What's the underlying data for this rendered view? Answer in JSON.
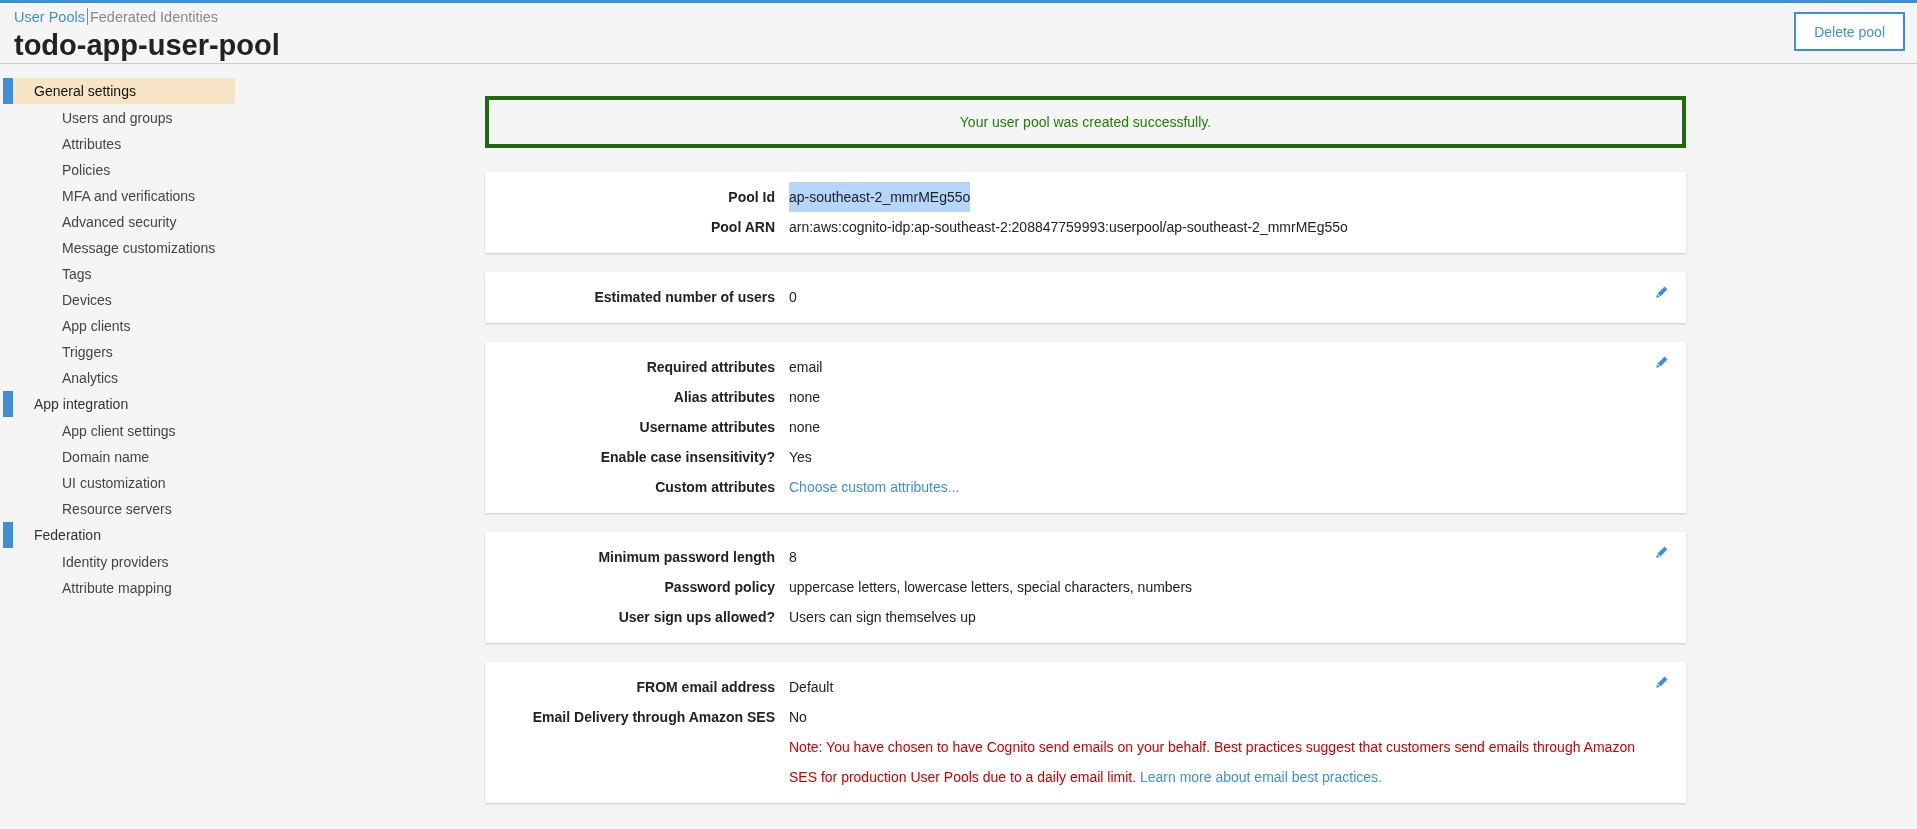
{
  "breadcrumb": [
    {
      "label": "User Pools",
      "selected": true
    },
    {
      "label": "Federated Identities",
      "selected": false
    }
  ],
  "title": "todo-app-user-pool",
  "delete_button": "Delete pool",
  "sidebar": {
    "items": [
      {
        "label": "General settings",
        "selected": true,
        "children": [
          {
            "label": "Users and groups"
          },
          {
            "label": "Attributes"
          },
          {
            "label": "Policies"
          },
          {
            "label": "MFA and verifications"
          },
          {
            "label": "Advanced security"
          },
          {
            "label": "Message customizations"
          },
          {
            "label": "Tags"
          },
          {
            "label": "Devices"
          },
          {
            "label": "App clients"
          },
          {
            "label": "Triggers"
          },
          {
            "label": "Analytics"
          }
        ]
      },
      {
        "label": "App integration",
        "selected": false,
        "children": [
          {
            "label": "App client settings"
          },
          {
            "label": "Domain name"
          },
          {
            "label": "UI customization"
          },
          {
            "label": "Resource servers"
          }
        ]
      },
      {
        "label": "Federation",
        "selected": false,
        "children": [
          {
            "label": "Identity providers"
          },
          {
            "label": "Attribute mapping"
          }
        ]
      }
    ]
  },
  "success_message": "Your user pool was created successfully.",
  "cards": [
    {
      "editable": false,
      "rows": [
        {
          "label": "Pool Id",
          "kind": "text",
          "value": "ap-southeast-2_mmrMEg55o",
          "highlighted": true
        },
        {
          "label": "Pool ARN",
          "kind": "text",
          "value": "arn:aws:cognito-idp:ap-southeast-2:208847759993:userpool/ap-southeast-2_mmrMEg55o",
          "highlighted": false
        }
      ]
    },
    {
      "editable": true,
      "rows": [
        {
          "label": "Estimated number of users",
          "kind": "text",
          "value": "0",
          "highlighted": false
        }
      ]
    },
    {
      "editable": true,
      "rows": [
        {
          "label": "Required attributes",
          "kind": "text",
          "value": "email",
          "highlighted": false
        },
        {
          "label": "Alias attributes",
          "kind": "text",
          "value": "none",
          "highlighted": false
        },
        {
          "label": "Username attributes",
          "kind": "text",
          "value": "none",
          "highlighted": false
        },
        {
          "label": "Enable case insensitivity?",
          "kind": "text",
          "value": "Yes",
          "highlighted": false
        },
        {
          "label": "Custom attributes",
          "kind": "link",
          "value": "Choose custom attributes...",
          "highlighted": false
        }
      ]
    },
    {
      "editable": true,
      "rows": [
        {
          "label": "Minimum password length",
          "kind": "text",
          "value": "8",
          "highlighted": false
        },
        {
          "label": "Password policy",
          "kind": "text",
          "value": "uppercase letters, lowercase letters, special characters, numbers",
          "highlighted": false
        },
        {
          "label": "User sign ups allowed?",
          "kind": "text",
          "value": "Users can sign themselves up",
          "highlighted": false
        }
      ]
    },
    {
      "editable": true,
      "rows": [
        {
          "label": "FROM email address",
          "kind": "text",
          "value": "Default",
          "highlighted": false
        },
        {
          "label": "Email Delivery through Amazon SES",
          "kind": "text",
          "value": "No",
          "highlighted": false
        },
        {
          "label": "",
          "kind": "note",
          "value": "Note: You have chosen to have Cognito send emails on your behalf. Best practices suggest that customers send emails through Amazon SES for production User Pools due to a daily email limit.",
          "link": "Learn more about email best practices.",
          "highlighted": false
        }
      ]
    }
  ]
}
